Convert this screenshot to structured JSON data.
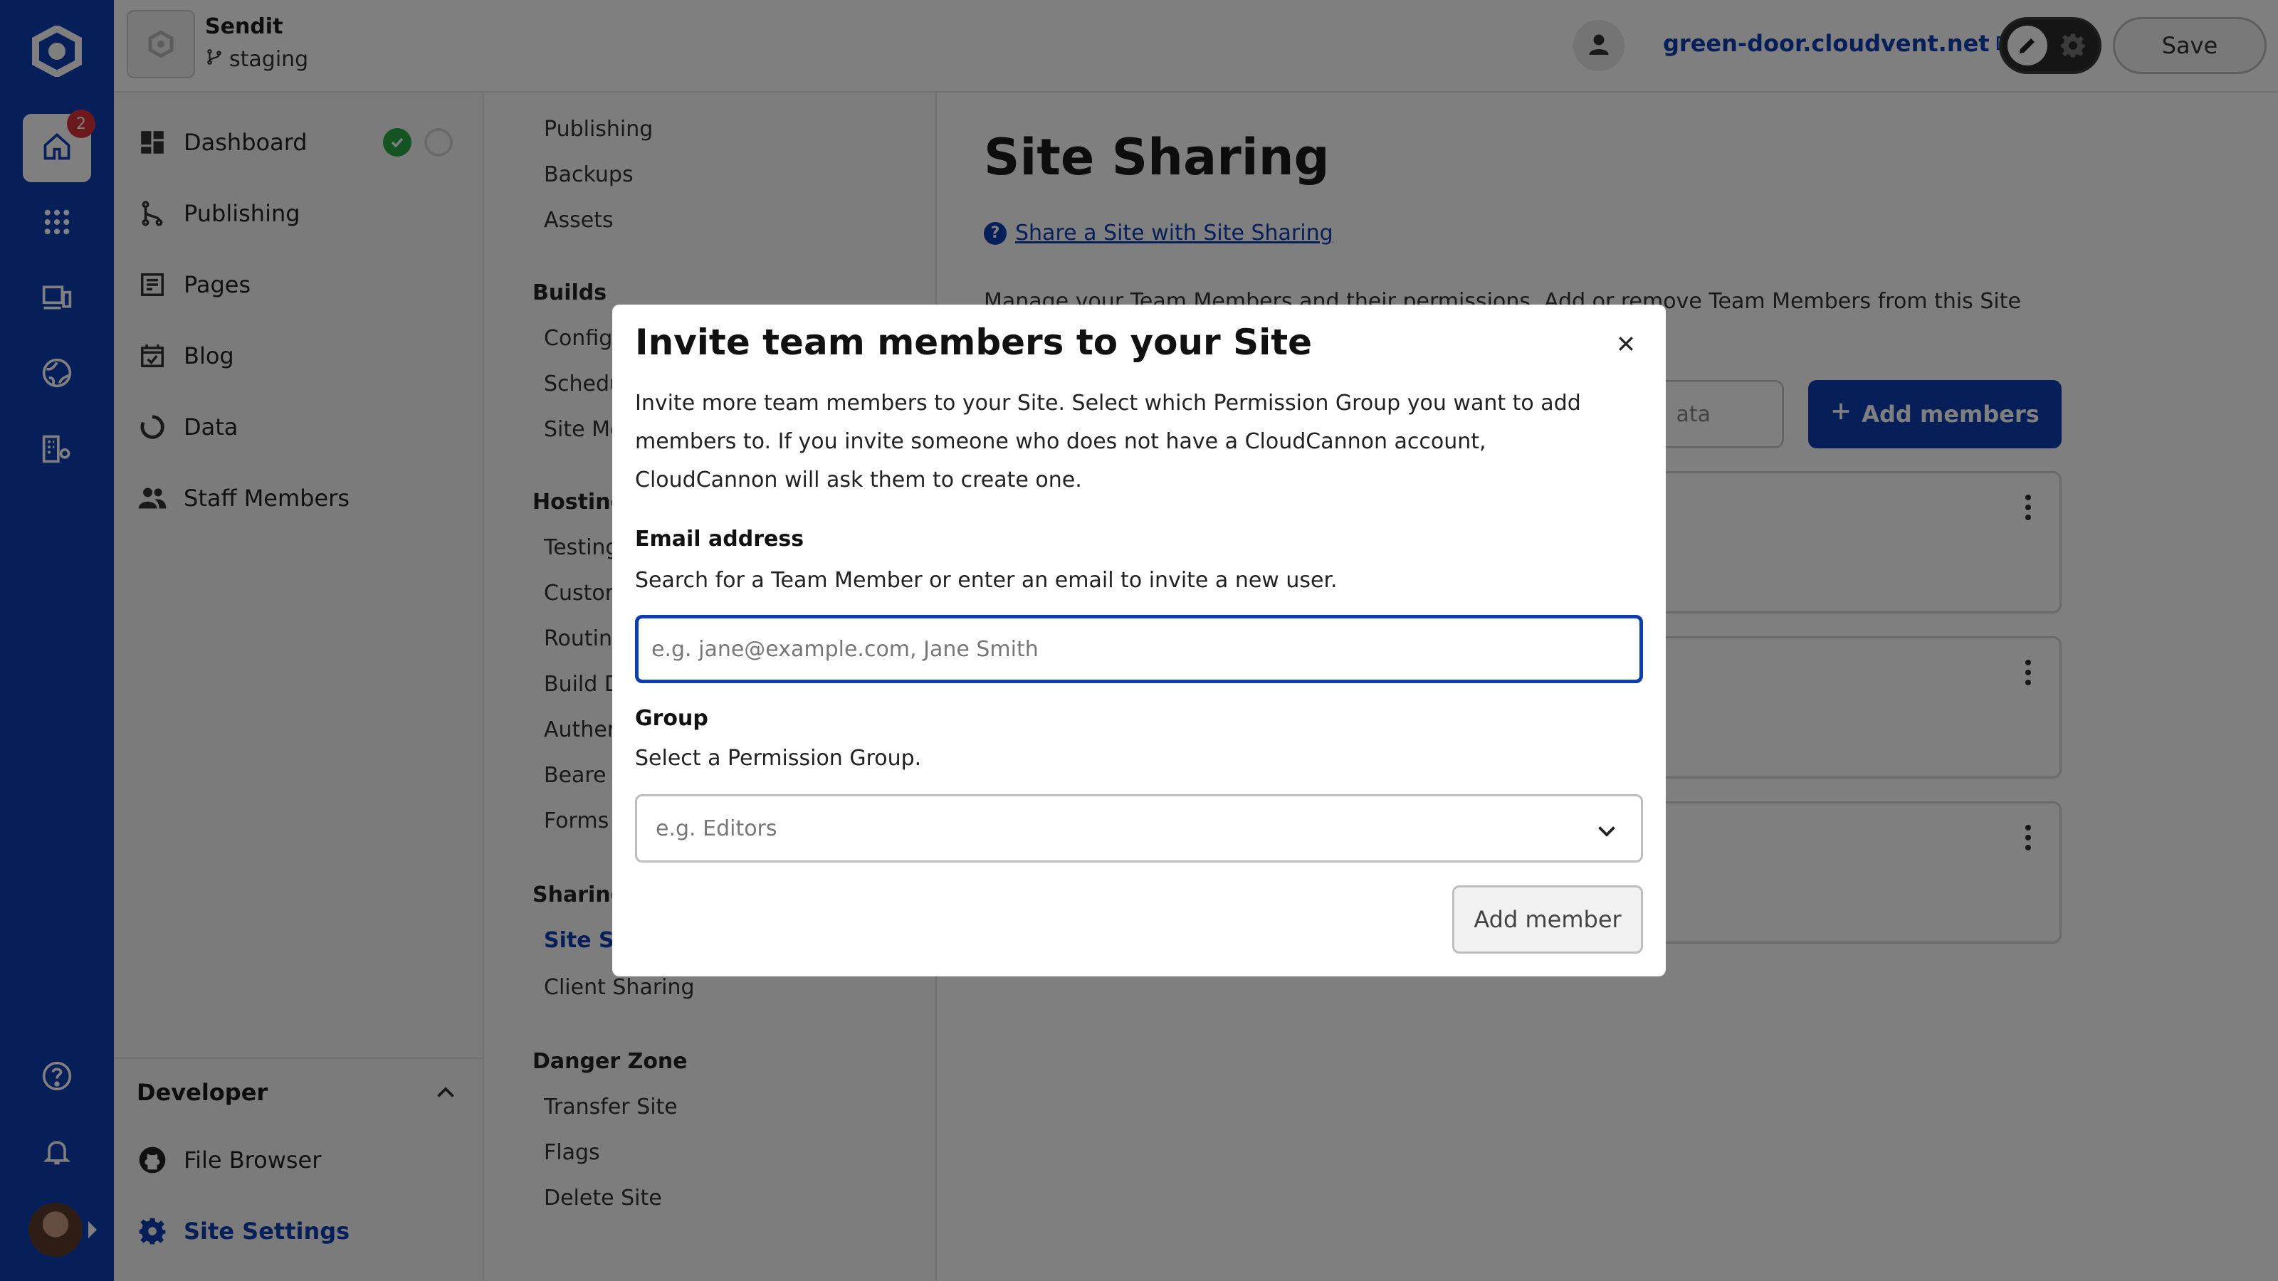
{
  "rail": {
    "notification_count": "2",
    "items": [
      "home-icon",
      "apps-grid-icon",
      "devices-icon",
      "globe-icon",
      "organization-settings-icon"
    ],
    "bottom": [
      "help-icon",
      "bell-icon"
    ]
  },
  "topbar": {
    "site_name": "Sendit",
    "branch": "staging",
    "domain": "green-door.cloudvent.net",
    "save_label": "Save"
  },
  "sidebar": {
    "items": [
      {
        "label": "Dashboard",
        "icon": "dashboard-icon"
      },
      {
        "label": "Publishing",
        "icon": "branch-icon"
      },
      {
        "label": "Pages",
        "icon": "page-icon"
      },
      {
        "label": "Blog",
        "icon": "calendar-check-icon"
      },
      {
        "label": "Data",
        "icon": "data-loader-icon"
      },
      {
        "label": "Staff Members",
        "icon": "people-icon"
      }
    ],
    "developer_heading": "Developer",
    "developer_items": [
      {
        "label": "File Browser",
        "icon": "github-icon"
      },
      {
        "label": "Site Settings",
        "icon": "gear-icon"
      }
    ]
  },
  "settings_nav": {
    "top_items": [
      "Publishing",
      "Backups",
      "Assets"
    ],
    "builds": {
      "heading": "Builds",
      "items": [
        "Config",
        "Schedu",
        "Site Mo"
      ]
    },
    "hosting": {
      "heading": "Hosting",
      "items": [
        "Testing",
        "Custon",
        "Routin",
        "Build D",
        "Auther",
        "Beare",
        "Forms"
      ]
    },
    "sharing": {
      "heading": "Sharing",
      "items": [
        "Site Sh",
        "Client Sharing"
      ]
    },
    "danger": {
      "heading": "Danger Zone",
      "items": [
        "Transfer Site",
        "Flags",
        "Delete Site"
      ]
    }
  },
  "main": {
    "title": "Site Sharing",
    "help_link": "Share a Site with Site Sharing",
    "description": "Manage your Team Members and their permissions. Add or remove Team Members from this Site and",
    "search_visible_text": "ata",
    "add_members_label": "Add members"
  },
  "modal": {
    "title": "Invite team members to your Site",
    "description": "Invite more team members to your Site. Select which Permission Group you want to add members to. If you invite someone who does not have a CloudCannon account, CloudCannon will ask them to create one.",
    "email_label": "Email address",
    "email_help": "Search for a Team Member or enter an email to invite a new user.",
    "email_placeholder": "e.g. jane@example.com, Jane Smith",
    "email_value": "",
    "group_label": "Group",
    "group_help": "Select a Permission Group.",
    "group_placeholder": "e.g. Editors",
    "submit_label": "Add member"
  },
  "colors": {
    "brand": "#0d3fb0",
    "success": "#27a844",
    "badge": "#d8323a"
  }
}
